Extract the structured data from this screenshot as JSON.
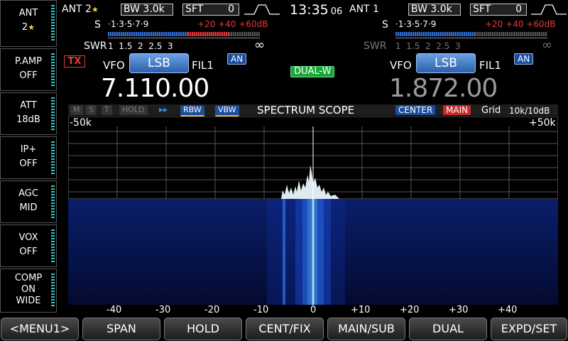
{
  "side": {
    "ant": {
      "label": "ANT",
      "value": "2"
    },
    "pamp": {
      "label": "P.AMP",
      "value": "OFF"
    },
    "att": {
      "label": "ATT",
      "value": "18dB"
    },
    "ip": {
      "label": "IP+",
      "value": "OFF"
    },
    "agc": {
      "label": "AGC",
      "value": "MID"
    },
    "vox": {
      "label": "VOX",
      "value": "OFF"
    },
    "comp": {
      "l1": "COMP",
      "l2": "ON",
      "l3": "WIDE"
    }
  },
  "main": {
    "ant": "ANT 2",
    "bw_label": "BW",
    "bw_value": "3.0k",
    "sft_label": "SFT",
    "sft_value": "0",
    "tx": "TX",
    "vfo": "VFO",
    "mode": "LSB",
    "fil": "FIL1",
    "an": "AN",
    "freq": "7.110.00"
  },
  "sub": {
    "ant": "ANT 1",
    "bw_label": "BW",
    "bw_value": "3.0k",
    "sft_label": "SFT",
    "sft_value": "0",
    "vfo": "VFO",
    "mode": "LSB",
    "fil": "FIL1",
    "an": "AN",
    "freq": "1.872.00"
  },
  "clock": {
    "hm": "13:35",
    "sec": "06"
  },
  "dual_w": "DUAL-W",
  "meter": {
    "s_label": "S",
    "s_scale": "·1·3·5·7·9",
    "s_plus": "+20 +40 +60dB",
    "swr_label": "SWR",
    "swr_scale": "1  1.5  2  2.5  3",
    "inf": "∞"
  },
  "scope": {
    "m": "M",
    "s": "S",
    "t": "T",
    "hold": "HOLD",
    "play": "▸▸",
    "rbw": "RBW",
    "vbw": "VBW",
    "title": "SPECTRUM SCOPE",
    "center": "CENTER",
    "main": "MAIN",
    "grid": "Grid",
    "range": "10k/10dB",
    "left": "-50k",
    "right": "+50k",
    "ticks": [
      "-40",
      "-30",
      "-20",
      "-10",
      "0",
      "+10",
      "+20",
      "+30",
      "+40"
    ]
  },
  "bottom": [
    "<MENU1>",
    "SPAN",
    "HOLD",
    "CENT/FIX",
    "MAIN/SUB",
    "DUAL",
    "EXPD/SET"
  ],
  "colors": {
    "accent": "#2ec4c4",
    "mode": "#3b74c4",
    "red": "#e23a3a",
    "green": "#1aa83a"
  }
}
